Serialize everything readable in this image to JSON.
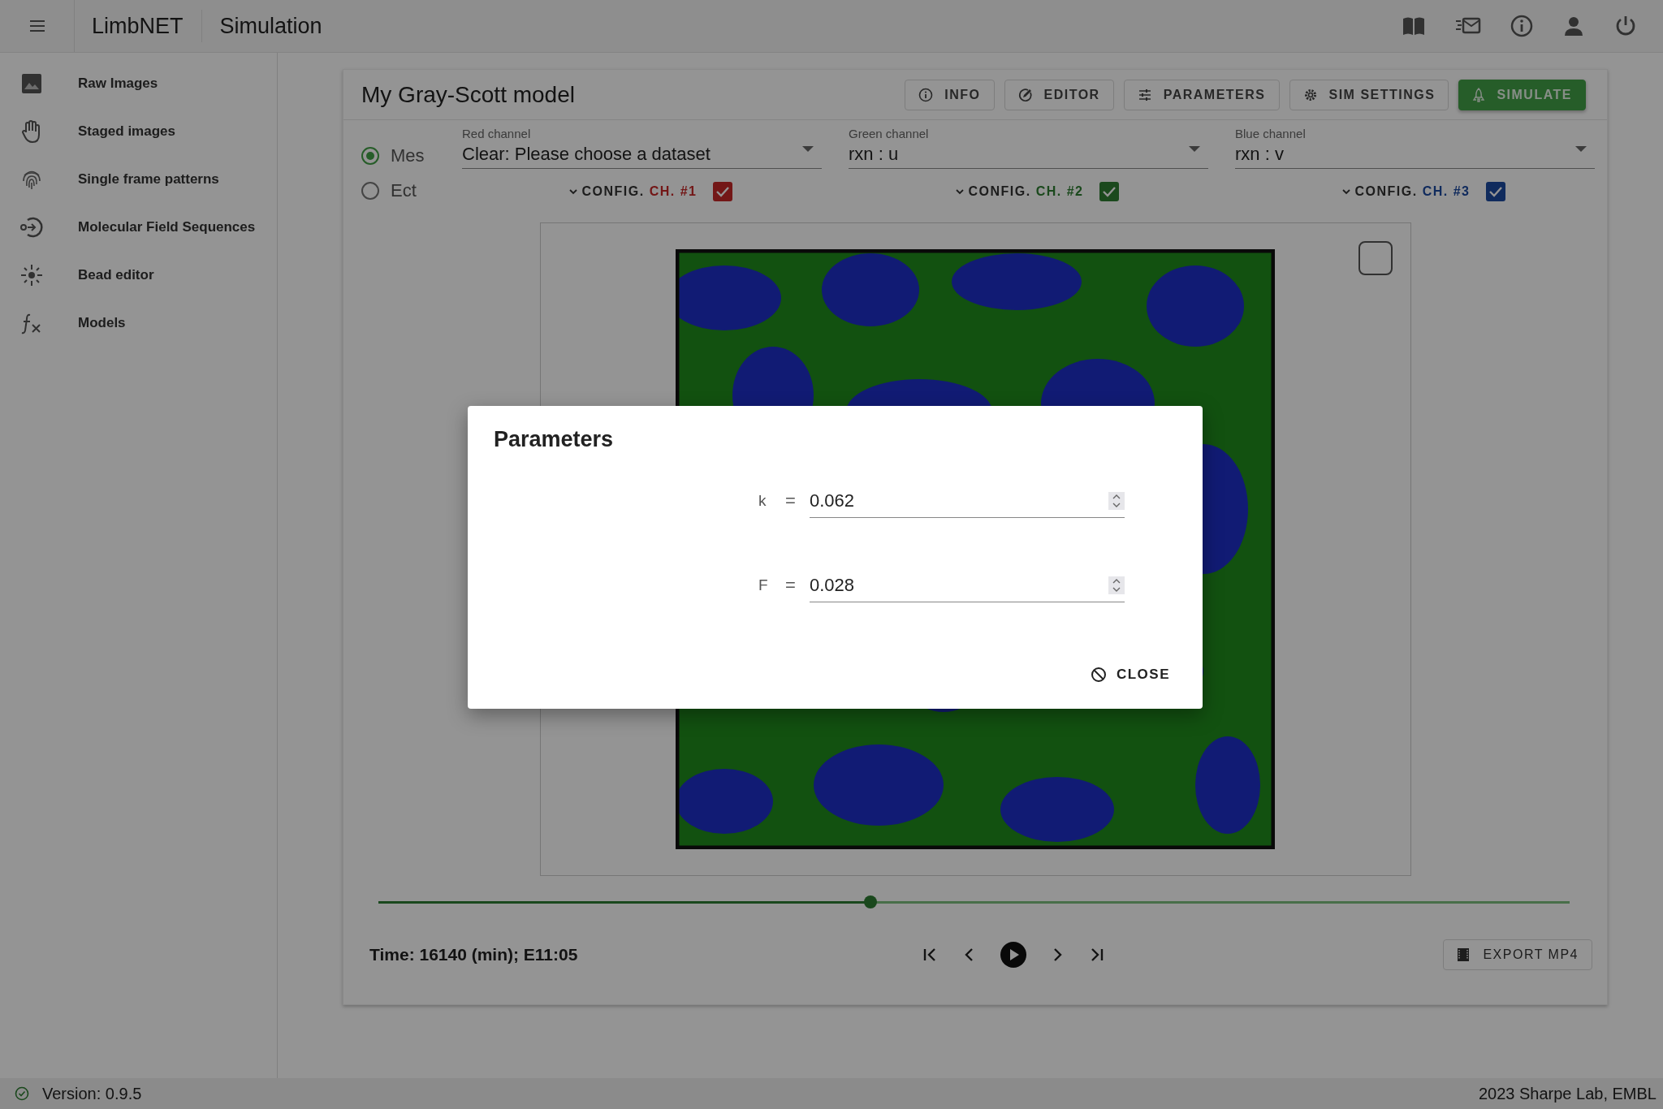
{
  "app_bar": {
    "title": "LimbNET",
    "page": "Simulation"
  },
  "sidebar": {
    "items": [
      {
        "label": "Raw Images"
      },
      {
        "label": "Staged images"
      },
      {
        "label": "Single frame patterns"
      },
      {
        "label": "Molecular Field Sequences"
      },
      {
        "label": "Bead editor"
      },
      {
        "label": "Models"
      }
    ]
  },
  "card": {
    "title": "My Gray-Scott model",
    "buttons": [
      {
        "label": "INFO",
        "primary": false
      },
      {
        "label": "EDITOR",
        "primary": false
      },
      {
        "label": "PARAMETERS",
        "primary": false
      },
      {
        "label": "SIM SETTINGS",
        "primary": false
      },
      {
        "label": "SIMULATE",
        "primary": true
      }
    ],
    "view_modes": [
      {
        "label": "Mes",
        "selected": true
      },
      {
        "label": "Ect",
        "selected": false
      }
    ],
    "channels": [
      {
        "label": "Red channel",
        "value": "Clear: Please choose a dataset",
        "config": "CONFIG.",
        "tag": "CH. #1",
        "checked": true,
        "color": "#731717"
      },
      {
        "label": "Green channel",
        "value": "rxn : u",
        "config": "CONFIG.",
        "tag": "CH. #2",
        "checked": true,
        "color": "#1b491d"
      },
      {
        "label": "Blue channel",
        "value": "rxn : v",
        "config": "CONFIG.",
        "tag": "CH. #3",
        "checked": true,
        "color": "#112b5d"
      }
    ],
    "frame_checkbox": {
      "checked": false
    },
    "timeline": {
      "level": 0.413
    },
    "time": "Time: 16140 (min); E11:05",
    "export_button": "EXPORT MP4"
  },
  "dialog": {
    "title": "Parameters",
    "fields": [
      {
        "name": "k",
        "operator": "=",
        "value": "0.062"
      },
      {
        "name": "F",
        "operator": "=",
        "value": "0.028"
      }
    ],
    "close": "CLOSE"
  },
  "footer": {
    "version": "Version: 0.9.5",
    "credit": "2023 Sharpe Lab, EMBL"
  }
}
